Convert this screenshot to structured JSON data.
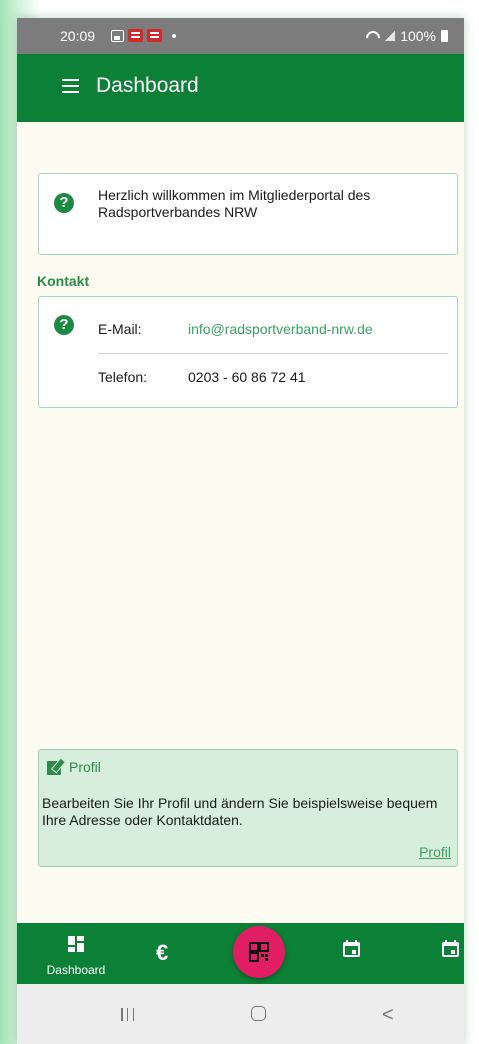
{
  "status_bar": {
    "time": "20:09",
    "battery": "100%"
  },
  "app_bar": {
    "title": "Dashboard"
  },
  "welcome": {
    "text": "Herzlich willkommen im Mitgliederportal des Radsportverbandes NRW"
  },
  "contact": {
    "section_label": "Kontakt",
    "email_label": "E-Mail:",
    "email_value": "info@radsportverband-nrw.de",
    "phone_label": "Telefon:",
    "phone_value": "0203 - 60 86 72 41"
  },
  "profile_card": {
    "title": "Profil",
    "body": "Bearbeiten Sie Ihr Profil und ändern Sie beispielsweise bequem Ihre Adresse oder Kontaktdaten.",
    "link": "Profil"
  },
  "bottom_nav": {
    "dashboard_label": "Dashboard",
    "euro_symbol": "€",
    "items": [
      "dashboard-icon",
      "euro-icon",
      "qr-scan-icon",
      "calendar-icon",
      "calendar-icon"
    ]
  },
  "colors": {
    "primary_green": "#0b8036",
    "fab_pink": "#e11d64",
    "link_green": "#3aa061",
    "profile_bg": "#d7eedd"
  }
}
